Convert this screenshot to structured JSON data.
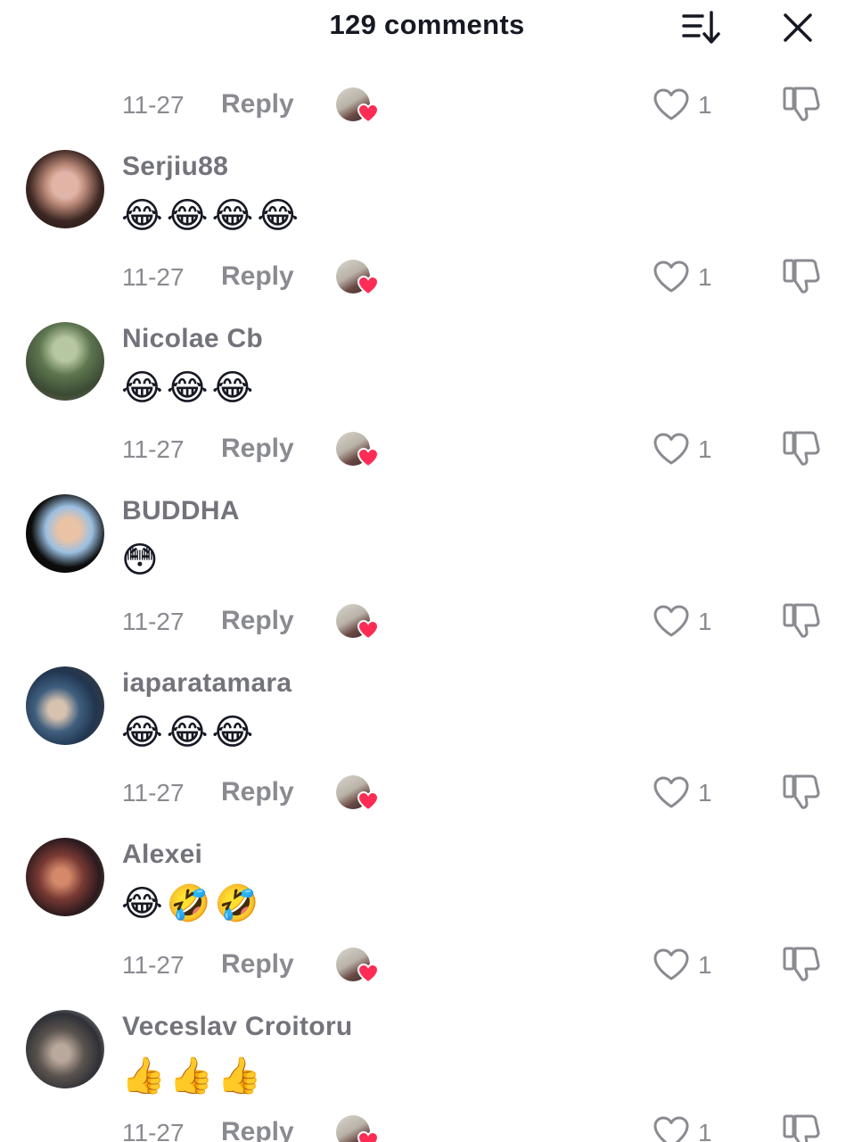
{
  "header": {
    "title": "129 comments",
    "sort_icon": "sort-descending-icon",
    "close_icon": "close-icon"
  },
  "colors": {
    "text_primary": "#161823",
    "text_secondary": "#8a8b91",
    "username": "#73747b",
    "heart_red": "#fe2c55"
  },
  "action_labels": {
    "reply": "Reply"
  },
  "top_action": {
    "date": "11-27",
    "likes": "1"
  },
  "comments": [
    {
      "username": "Serjiu88",
      "text": "😂😂😂😂",
      "date": "11-27",
      "likes": "1"
    },
    {
      "username": "Nicolae Cb",
      "text": "😂😂😂",
      "date": "11-27",
      "likes": "1"
    },
    {
      "username": "BUDDHA",
      "text": "😳",
      "date": "11-27",
      "likes": "1"
    },
    {
      "username": "iaparatamara",
      "text": "😂😂😂",
      "date": "11-27",
      "likes": "1"
    },
    {
      "username": "Alexei",
      "text": "😂🤣🤣",
      "date": "11-27",
      "likes": "1"
    },
    {
      "username": "Veceslav Croitoru",
      "text": "👍👍👍",
      "date": "11-27",
      "likes": "1"
    }
  ]
}
